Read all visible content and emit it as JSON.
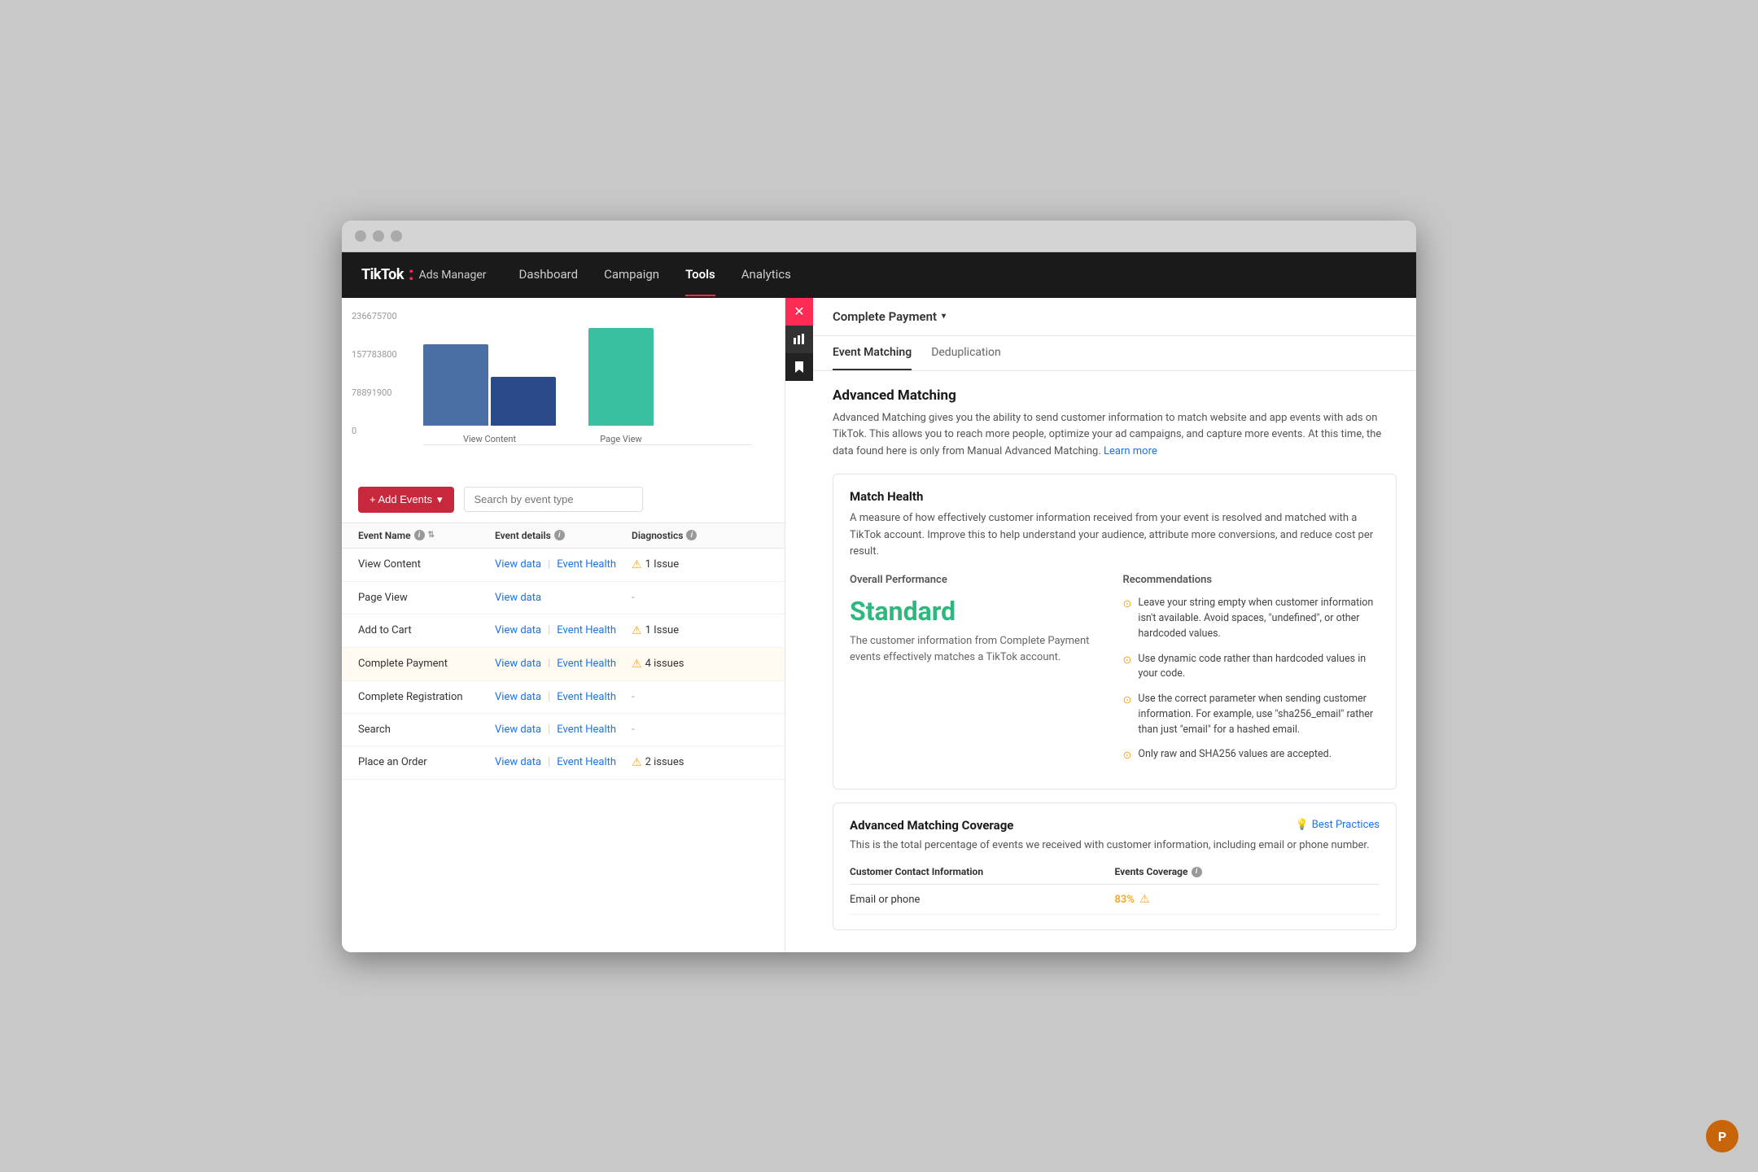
{
  "browser": {
    "dots": [
      "dot1",
      "dot2",
      "dot3"
    ]
  },
  "nav": {
    "logo": "TikTok",
    "logo_dot": ":",
    "logo_sub": "Ads Manager",
    "links": [
      {
        "label": "Dashboard",
        "active": false
      },
      {
        "label": "Campaign",
        "active": false
      },
      {
        "label": "Tools",
        "active": true
      },
      {
        "label": "Analytics",
        "active": false
      }
    ]
  },
  "chart": {
    "y_labels": [
      "236675700",
      "157783800",
      "78891900",
      "0"
    ],
    "bars": [
      {
        "label": "View Content",
        "color1": "#4a6fa5",
        "color2": "#2a4a8a",
        "height1": 100,
        "height2": 60
      },
      {
        "label": "Page View",
        "color1": "#3abfa0",
        "height1": 120,
        "height2": 0
      }
    ]
  },
  "toolbar": {
    "add_events_label": "+ Add Events",
    "search_placeholder": "Search by event type"
  },
  "table": {
    "headers": [
      {
        "label": "Event Name",
        "has_sort": true,
        "has_info": true
      },
      {
        "label": "Event details",
        "has_info": true
      },
      {
        "label": "Diagnostics",
        "has_info": true
      }
    ],
    "rows": [
      {
        "name": "View Content",
        "has_view_data": true,
        "has_event_health": true,
        "diagnostics": "1 Issue",
        "has_issue": true,
        "highlighted": false
      },
      {
        "name": "Page View",
        "has_view_data": true,
        "has_event_health": false,
        "diagnostics": "-",
        "has_issue": false,
        "highlighted": false
      },
      {
        "name": "Add to Cart",
        "has_view_data": true,
        "has_event_health": true,
        "diagnostics": "1 Issue",
        "has_issue": true,
        "highlighted": false
      },
      {
        "name": "Complete Payment",
        "has_view_data": true,
        "has_event_health": true,
        "diagnostics": "4 issues",
        "has_issue": true,
        "highlighted": true
      },
      {
        "name": "Complete Registration",
        "has_view_data": true,
        "has_event_health": true,
        "diagnostics": "-",
        "has_issue": false,
        "highlighted": false
      },
      {
        "name": "Search",
        "has_view_data": true,
        "has_event_health": true,
        "diagnostics": "-",
        "has_issue": false,
        "highlighted": false
      },
      {
        "name": "Place an Order",
        "has_view_data": true,
        "has_event_health": true,
        "diagnostics": "2 issues",
        "has_issue": true,
        "highlighted": false
      }
    ]
  },
  "right_panel": {
    "title": "Complete Payment",
    "chevron": "▾",
    "tabs": [
      {
        "label": "Event Matching",
        "active": true
      },
      {
        "label": "Deduplication",
        "active": false
      }
    ],
    "advanced_matching": {
      "title": "Advanced Matching",
      "desc": "Advanced Matching gives you the ability to send customer information to match website and app events with ads on TikTok. This allows you to reach more people, optimize your ad campaigns, and capture more events. At this time, the data found here is only from Manual Advanced Matching.",
      "learn_more": "Learn more"
    },
    "match_health": {
      "title": "Match Health",
      "desc": "A measure of how effectively customer information received from your event is resolved and matched with a TikTok account. Improve this to help understand your audience, attribute more conversions, and reduce cost per result."
    },
    "overall_performance": {
      "label": "Overall Performance",
      "status": "Standard",
      "status_color": "#2db87d",
      "desc": "The customer information from Complete Payment events effectively matches a TikTok account."
    },
    "recommendations": {
      "label": "Recommendations",
      "items": [
        "Leave your string empty when customer information isn't available. Avoid spaces, \"undefined\", or other hardcoded values.",
        "Use dynamic code rather than hardcoded values in your code.",
        "Use the correct parameter when sending customer information. For example, use \"sha256_email\" rather than just \"email\" for a hashed email.",
        "Only raw and SHA256 values are accepted."
      ]
    },
    "coverage": {
      "title": "Advanced Matching Coverage",
      "best_practices": "Best Practices",
      "desc": "This is the total percentage of events we received with customer information, including email or phone number.",
      "table_headers": [
        "Customer Contact Information",
        "Events Coverage"
      ],
      "rows": [
        {
          "label": "Email or phone",
          "pct": "83%",
          "has_warning": true
        }
      ]
    }
  },
  "avatar": {
    "initial": "P",
    "color": "#c8650a"
  }
}
